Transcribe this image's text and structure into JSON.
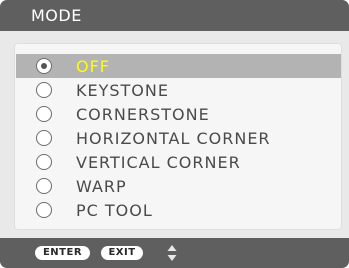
{
  "title": "MODE",
  "options": [
    {
      "label": "OFF",
      "selected": true
    },
    {
      "label": "KEYSTONE",
      "selected": false
    },
    {
      "label": "CORNERSTONE",
      "selected": false
    },
    {
      "label": "HORIZONTAL CORNER",
      "selected": false
    },
    {
      "label": "VERTICAL CORNER",
      "selected": false
    },
    {
      "label": "WARP",
      "selected": false
    },
    {
      "label": "PC TOOL",
      "selected": false
    }
  ],
  "footer": {
    "enter_label": "ENTER",
    "exit_label": "EXIT",
    "nav_icon": "up-down-arrows-icon"
  },
  "colors": {
    "title_bar": "#5f5f5f",
    "background": "#e9e9e9",
    "panel": "#f6f6f6",
    "selected_row": "#b3b3b3",
    "selected_text": "#ffff00",
    "text": "#4a4a4a"
  }
}
